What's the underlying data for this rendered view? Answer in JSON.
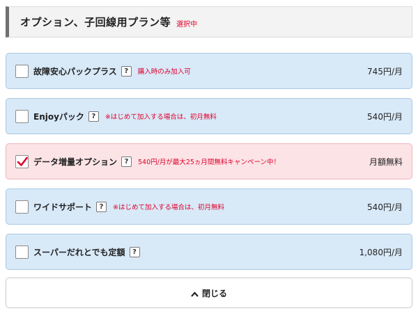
{
  "header": {
    "title": "オプション、子回線用プラン等",
    "badge": "選択中"
  },
  "options": [
    {
      "name": "故障安心パックプラス",
      "help": "?",
      "note": "購入時のみ加入可",
      "price": "745円/月",
      "checked": false
    },
    {
      "name": "Enjoyパック",
      "help": "?",
      "note": "※はじめて加入する場合は、初月無料",
      "price": "540円/月",
      "checked": false
    },
    {
      "name": "データ増量オプション",
      "help": "?",
      "note": "540円/月が最大25ヵ月間無料キャンペーン中！",
      "price": "月額無料",
      "checked": true
    },
    {
      "name": "ワイドサポート",
      "help": "?",
      "note": "※はじめて加入する場合は、初月無料",
      "price": "540円/月",
      "checked": false
    },
    {
      "name": "スーパーだれとでも定額",
      "help": "?",
      "note": "",
      "price": "1,080円/月",
      "checked": false
    }
  ],
  "close_button": {
    "label": "閉じる",
    "icon": "chevron-up-icon"
  },
  "colors": {
    "accent_red": "#e0002a",
    "option_bg": "#d8e9f8",
    "selected_bg": "#fbe3e6"
  }
}
